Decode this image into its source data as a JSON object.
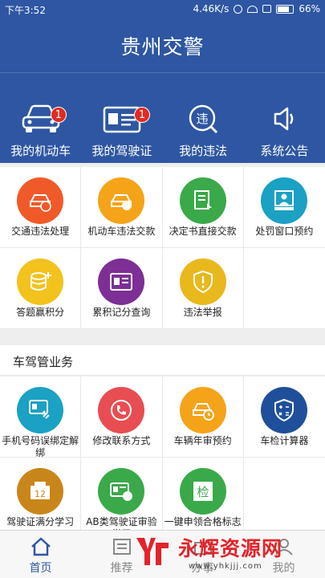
{
  "status_bar": {
    "time": "下午3:52",
    "speed": "4.46K/s",
    "battery": "66%"
  },
  "header": {
    "title": "贵州交警"
  },
  "top_nav": [
    {
      "label": "我的机动车",
      "badge": "1",
      "icon": "car-icon"
    },
    {
      "label": "我的驾驶证",
      "badge": "1",
      "icon": "license-card-icon"
    },
    {
      "label": "我的违法",
      "icon": "violation-icon"
    },
    {
      "label": "系统公告",
      "icon": "speaker-icon"
    }
  ],
  "services": [
    {
      "label": "交通违法处理",
      "color": "#f05a28"
    },
    {
      "label": "机动车违法交款",
      "color": "#f5a318"
    },
    {
      "label": "决定书直接交款",
      "color": "#3aa94a"
    },
    {
      "label": "处罚窗口预约",
      "color": "#1aa1c4"
    },
    {
      "label": "答题赢积分",
      "color": "#f3c21d"
    },
    {
      "label": "累积记分查询",
      "color": "#7d2f96"
    },
    {
      "label": "违法举报",
      "color": "#e8b81c"
    }
  ],
  "section": {
    "title": "车驾管业务"
  },
  "vehicle_services": [
    {
      "label": "手机号码误绑定解绑",
      "color": "#1aa1c4"
    },
    {
      "label": "修改联系方式",
      "color": "#e84d52"
    },
    {
      "label": "车辆年审预约",
      "color": "#f5a318"
    },
    {
      "label": "车检计算器",
      "color": "#1f4f9a"
    },
    {
      "label": "驾驶证满分学习",
      "color": "#c8861a"
    },
    {
      "label": "AB类驾驶证审验学习",
      "color": "#3aa94a"
    },
    {
      "label": "一键申领合格标志",
      "color": "#3aa94a"
    }
  ],
  "bottom_nav": [
    {
      "label": "首页",
      "active": true
    },
    {
      "label": "推荐"
    },
    {
      "label": "办事"
    },
    {
      "label": "我的"
    }
  ],
  "watermark": {
    "text": "永辉资源网",
    "url": "www.yhkjjj.com"
  },
  "colors": {
    "primary": "#2e56a2",
    "badge": "#e02b22",
    "active_tab": "#2e56a2"
  }
}
